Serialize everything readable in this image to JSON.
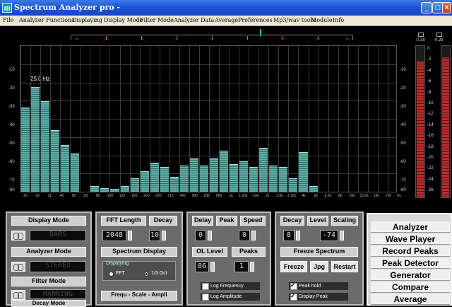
{
  "window": {
    "title": "Spectrum Analyzer pro -"
  },
  "menu": [
    "File",
    "Analyzer Functions",
    "Displaying",
    "Display Mode",
    "Filter Mode",
    "Analyzer Data",
    "Average",
    "Preferences",
    "Mp3/wav tools",
    "Module",
    "Info"
  ],
  "scale_strip": [
    "-30",
    "-20",
    "-10",
    "-5",
    "0",
    "5",
    "10",
    "20",
    "30"
  ],
  "spectrum": {
    "peak_label": "25.0 Hz",
    "y_ticks": [
      "-10",
      "-20",
      "-30",
      "-40",
      "-50",
      "-60",
      "-70",
      "-80"
    ],
    "x_ticks": [
      "20",
      "25",
      "31",
      "40",
      "50",
      "63",
      "80",
      "100",
      "125",
      "160",
      "200",
      "250",
      "315",
      "400",
      "500",
      "630",
      "800",
      "1k",
      "1.25k",
      "1.6k",
      "2k",
      "2.5k",
      "3.15k",
      "4k",
      "5k",
      "6.3k",
      "8k",
      "10k",
      "12.5k",
      "16k",
      "20k"
    ],
    "x_unit": "Hz",
    "levels": [
      0.58,
      0.72,
      0.62,
      0.42,
      0.32,
      0.26,
      0,
      0.04,
      0.025,
      0.02,
      0.04,
      0.09,
      0.14,
      0.2,
      0.17,
      0.1,
      0.18,
      0.23,
      0.18,
      0.23,
      0.28,
      0.19,
      0.21,
      0.17,
      0.3,
      0.18,
      0.17,
      0.09,
      0.27,
      0.04,
      0,
      0,
      0,
      0,
      0,
      0,
      0,
      0
    ]
  },
  "meters": {
    "left": "-0.38",
    "right": "-0.28",
    "left_level": 0.9,
    "right_level": 0.93,
    "scale": [
      "0",
      "-2",
      "-4",
      "-6",
      "-8",
      "-10",
      "-12",
      "-14",
      "-16",
      "-18",
      "-20",
      "-22",
      "-24",
      "-26"
    ]
  },
  "panel1": {
    "display_mode": "Display Mode",
    "display_lcd": "BARS",
    "analyzer_mode": "Analyzer Mode",
    "analyzer_lcd": "STEREO",
    "filter_mode": "Filter Mode",
    "filter_lcd": "HANNING",
    "decay_mode": "Decay Mode"
  },
  "panel2": {
    "fft_length": "FFT Length",
    "fft_value": "2048",
    "decay": "Decay",
    "decay_value": "10",
    "spectrum_display": "Spectrum Display",
    "displaying": "Displaying",
    "radio_fft": "FFT",
    "radio_oct": "1/3 Oct",
    "frequ": "Frequ - Scale - Ampli"
  },
  "panel3": {
    "delay": "Delay",
    "delay_value": "0",
    "peak": "Peak",
    "speed": "Speed",
    "speed_value": "0",
    "ol_level": "OL Level",
    "ol_value": "86",
    "peaks": "Peaks",
    "peaks_value": "1",
    "chk_log_freq": "Log Frequency",
    "chk_log_amp": "Log Amplitude"
  },
  "panel4": {
    "decay": "Decay",
    "level": "Level",
    "scaling": "Scaling",
    "decay_value": "8",
    "level_value": "-74",
    "freeze_spectrum": "Freeze Spectrum",
    "freeze": "Freeze",
    "jpg": "Jpg",
    "restart": "Restart",
    "chk_peak_hold": "Peak hold",
    "chk_display_peak": "Display Peak"
  },
  "right_menu": [
    "Analyzer",
    "Wave Player",
    "Record Peaks",
    "Peak Detector",
    "Generator",
    "Compare",
    "Average"
  ]
}
